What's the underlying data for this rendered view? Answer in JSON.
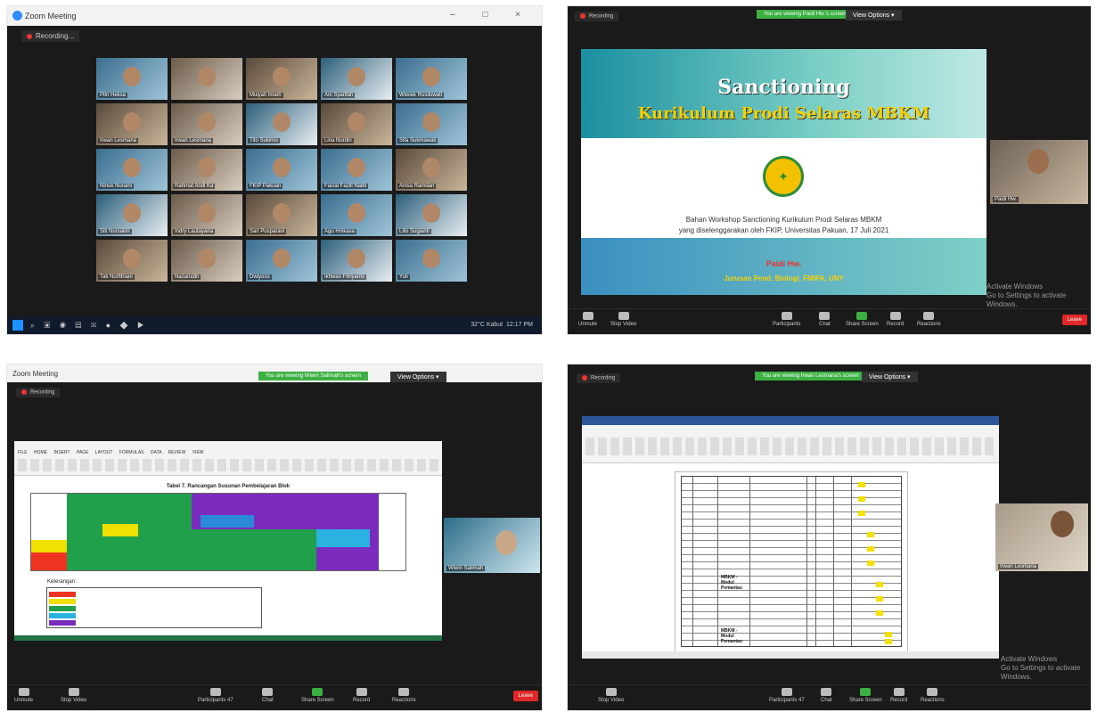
{
  "panel1": {
    "title": "Zoom Meeting",
    "recording": "Recording...",
    "window_controls": "– □ ×",
    "participants": [
      "Pitri Heksa",
      "",
      "Mulyati Imam",
      "Ani Syarifah",
      "Wiwiek Rusilowati",
      "Irwan Lesmana",
      "Irwan Lesmana",
      "Tito Sukirno",
      "Lina Nurdin",
      "Sifa Sukmawati",
      "Ninuk Nuraini",
      "Rahmat Andi Ka",
      "FKIP Pakuan",
      "Faizal Fazlil Nalbi",
      "Anisa Ramdan",
      "Siti Nursalim",
      "Indry Lautayana",
      "Sari Pusparani",
      "Agu Hnikasa",
      "Lilis Sugianti",
      "Tati Nurfitriani",
      "Nazarudin",
      "Dwiyoso",
      "Ikhwan Fitriyanto",
      "Yuli"
    ],
    "taskbar_weather": "32°C Kabut",
    "taskbar_time": "12:17 PM"
  },
  "panel2": {
    "recording": "Recording",
    "sharing_banner": "You are viewing Paidi Hw.'s screen",
    "view_options": "View Options ▾",
    "slide": {
      "title": "Sanctioning",
      "subtitle": "Kurikulum Prodi Selaras MBKM",
      "desc_line1": "Bahan Workshop Sanctioning Kurikulum Prodi Selaras MBKM",
      "desc_line2": "yang diselenggarakan oleh FKIP, Universitas Pakuan, 17 Juli 2021",
      "author": "Paidi Hw.",
      "department": "Jurusan Pend. Biologi, FMIPA, UNY"
    },
    "speaker_name": "Paidi Hw.",
    "activate_line1": "Activate Windows",
    "activate_line2": "Go to Settings to activate Windows.",
    "toolbar": {
      "unmute": "Unmute",
      "stop_video": "Stop Video",
      "participants": "Participants",
      "chat": "Chat",
      "share_screen": "Share Screen",
      "record": "Record",
      "reactions": "Reactions",
      "leave": "Leave"
    }
  },
  "panel3": {
    "title": "Zoom Meeting",
    "recording": "Recording",
    "sharing_banner": "You are viewing Wiwin Salimah's screen",
    "view_options": "View Options ▾",
    "excel_title": "Tabel 7. Rancangan Susunan Pembelajaran Blok",
    "ribbon_tabs": "FILE HOME INSERT PAGE LAYOUT FORMULAS DATA REVIEW VIEW",
    "legend_title": "Keterangan :",
    "speaker_name": "Wiwin Salimah",
    "toolbar": {
      "unmute": "Unmute",
      "stop_video": "Stop Video",
      "participants": "Participants",
      "participants_count": "47",
      "chat": "Chat",
      "share_screen": "Share Screen",
      "record": "Record",
      "reactions": "Reactions",
      "leave": "Leave"
    }
  },
  "panel4": {
    "recording": "Recording",
    "sharing_banner": "You are viewing Irwan Lesmana's screen",
    "view_options": "View Options ▾",
    "doc_labels": [
      "MBKM - Modul Pemantau",
      "MBKM - Modul Pemantau"
    ],
    "speaker_name": "Irwan Lesmana",
    "activate_line1": "Activate Windows",
    "activate_line2": "Go to Settings to activate Windows.",
    "toolbar": {
      "stop_video": "Stop Video",
      "participants": "Participants",
      "participants_count": "47",
      "chat": "Chat",
      "share_screen": "Share Screen",
      "record": "Record",
      "reactions": "Reactions"
    }
  }
}
